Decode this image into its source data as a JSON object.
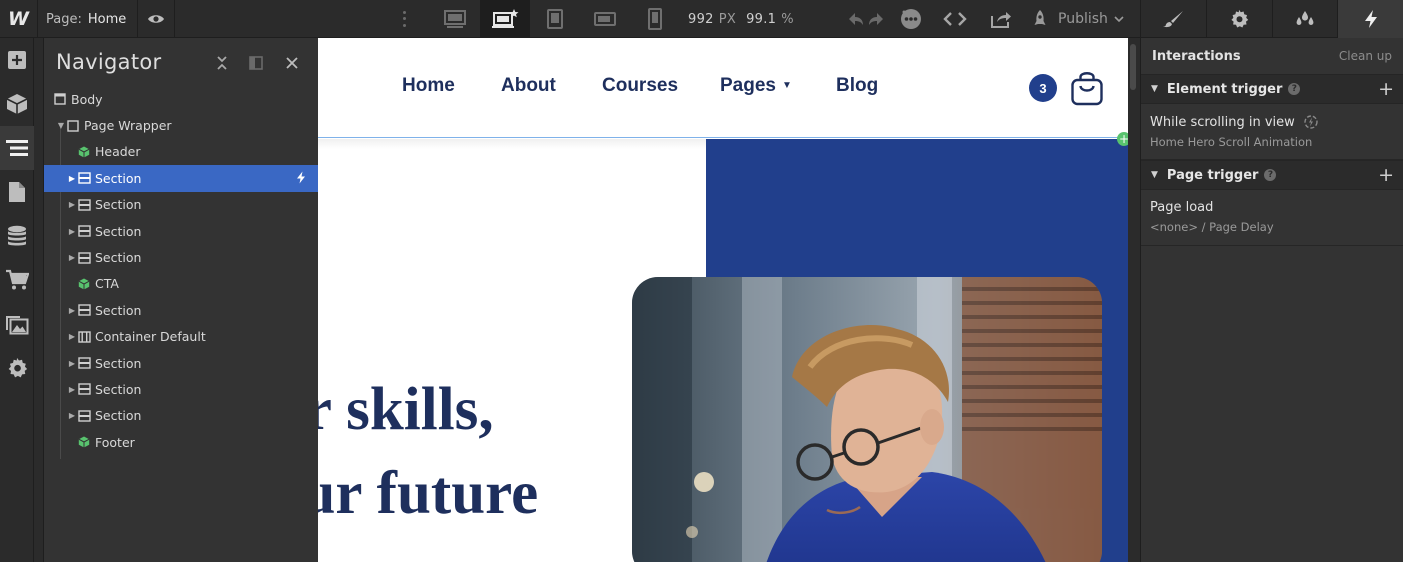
{
  "topbar": {
    "logo": "W",
    "page_label": "Page:",
    "page_name": "Home",
    "canvas_width": "992",
    "canvas_width_unit": "PX",
    "zoom": "99.1",
    "zoom_unit": "%",
    "publish_label": "Publish",
    "breakpoints": [
      "desktop-large-icon",
      "desktop-base-icon",
      "tablet-icon",
      "mobile-landscape-icon",
      "mobile-portrait-icon"
    ],
    "active_breakpoint": "desktop-base-icon",
    "right_tabs": [
      "brush-icon",
      "gear-icon",
      "drops-icon",
      "bolt-icon"
    ],
    "active_tab": "bolt-icon"
  },
  "rail": {
    "items": [
      "add-icon",
      "box-icon",
      "navigator-icon",
      "pages-icon",
      "cms-icon",
      "ecommerce-icon",
      "assets-icon",
      "settings-icon"
    ],
    "active": "navigator-icon"
  },
  "navigator": {
    "title": "Navigator",
    "tree": [
      {
        "label": "Body",
        "type": "body",
        "depth": 0,
        "caret": false
      },
      {
        "label": "Page Wrapper",
        "type": "div",
        "depth": 1,
        "caret": "open"
      },
      {
        "label": "Header",
        "type": "symbol",
        "depth": 2,
        "caret": false
      },
      {
        "label": "Section",
        "type": "section",
        "depth": 2,
        "caret": "closed",
        "selected": true,
        "interaction": true
      },
      {
        "label": "Section",
        "type": "section",
        "depth": 2,
        "caret": "closed"
      },
      {
        "label": "Section",
        "type": "section",
        "depth": 2,
        "caret": "closed"
      },
      {
        "label": "Section",
        "type": "section",
        "depth": 2,
        "caret": "closed"
      },
      {
        "label": "CTA",
        "type": "symbol",
        "depth": 2,
        "caret": false
      },
      {
        "label": "Section",
        "type": "section",
        "depth": 2,
        "caret": "closed"
      },
      {
        "label": "Container Default",
        "type": "container",
        "depth": 2,
        "caret": "closed"
      },
      {
        "label": "Section",
        "type": "section",
        "depth": 2,
        "caret": "closed"
      },
      {
        "label": "Section",
        "type": "section",
        "depth": 2,
        "caret": "closed"
      },
      {
        "label": "Section",
        "type": "section",
        "depth": 2,
        "caret": "closed"
      },
      {
        "label": "Footer",
        "type": "symbol",
        "depth": 2,
        "caret": false
      }
    ]
  },
  "site": {
    "nav_links": [
      "Home",
      "About",
      "Courses",
      "Pages",
      "Blog"
    ],
    "cart_count": "3",
    "hero_line1": "ur skills,",
    "hero_line2": "our future",
    "colors": {
      "primary": "#213f8c",
      "heading": "#1e2f5d",
      "selection": "#3a68c4",
      "symbol": "#58c36e"
    }
  },
  "interactions": {
    "title": "Interactions",
    "clean_up": "Clean up",
    "element_trigger_title": "Element trigger",
    "element_trigger_item_title": "While scrolling in view",
    "element_trigger_item_sub": "Home Hero Scroll Animation",
    "page_trigger_title": "Page trigger",
    "page_trigger_item_title": "Page load",
    "page_trigger_item_sub": "<none> / Page Delay"
  }
}
